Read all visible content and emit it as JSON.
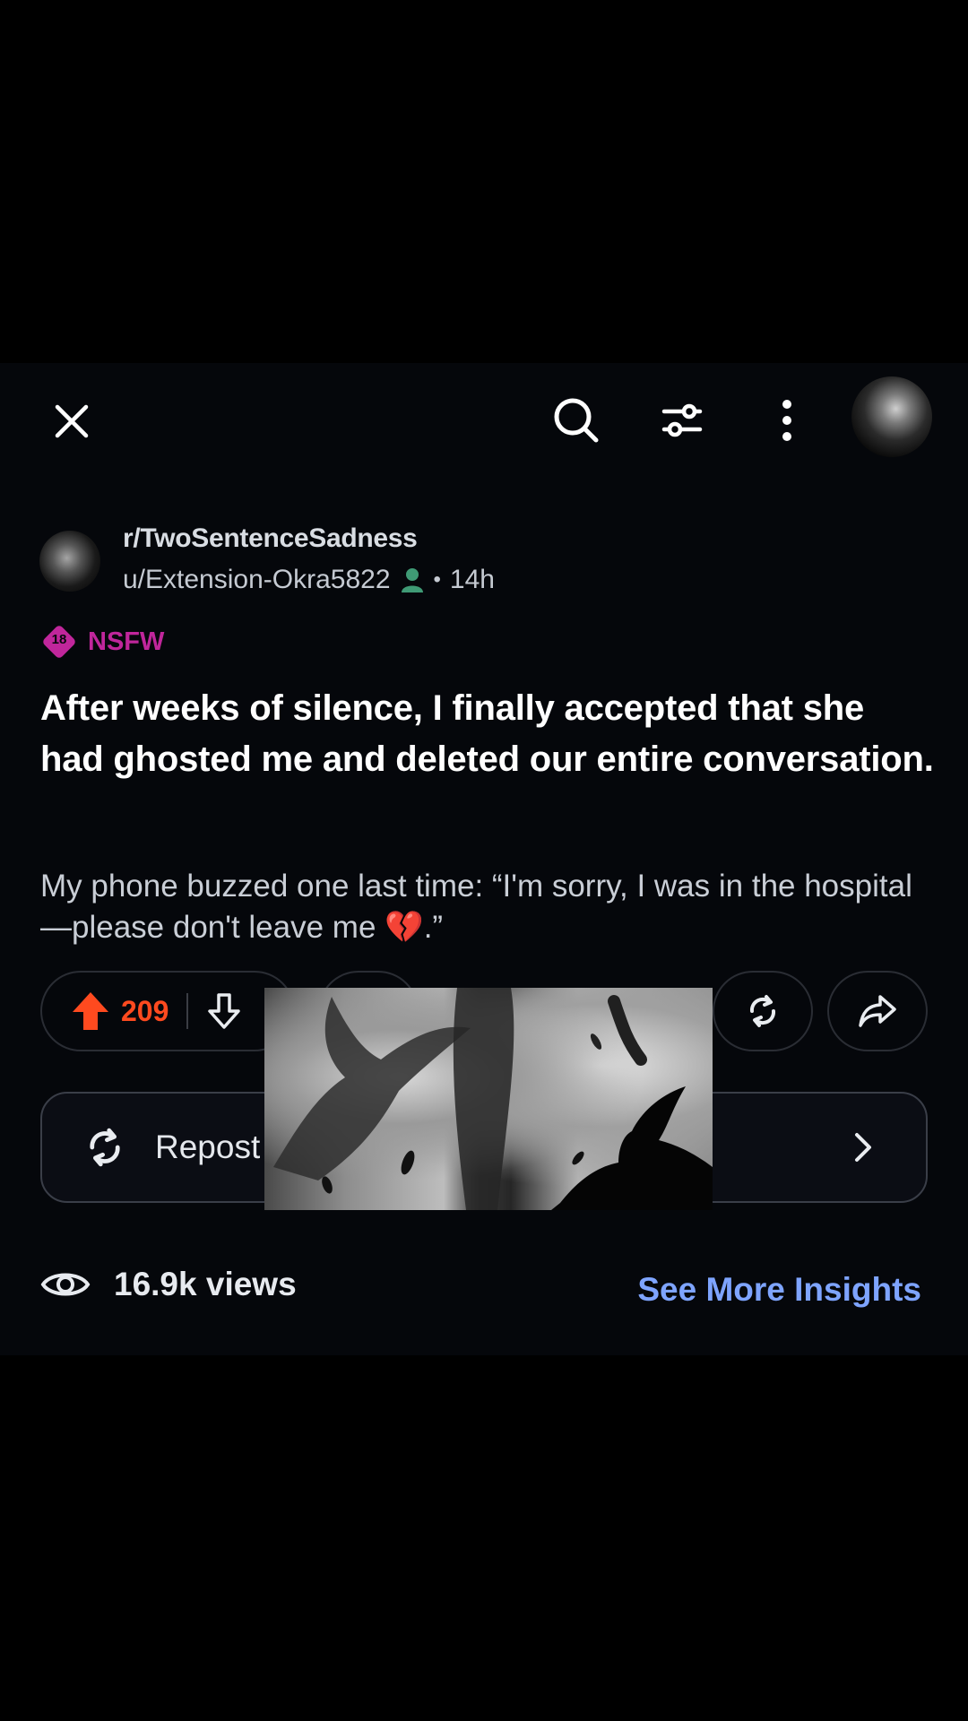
{
  "header": {
    "close_icon": "close-icon",
    "search_icon": "search-icon",
    "filter_icon": "filter-icon",
    "more_icon": "more-vertical-icon",
    "avatar_icon": "avatar"
  },
  "post": {
    "subreddit": "r/TwoSentenceSadness",
    "username": "u/Extension-Okra5822",
    "separator": "•",
    "time": "14h",
    "nsfw_badge": "18",
    "nsfw_label": "NSFW",
    "title": "After weeks of silence, I finally accepted that she had ghosted me and deleted our entire conversation.",
    "body": "My phone buzzed one last time: “I'm sorry, I was in the hospital—please don't leave me 💔.”"
  },
  "actions": {
    "upvotes": "209",
    "repost_label": "Repost"
  },
  "insights": {
    "views": "16.9k views",
    "see_more": "See More Insights"
  },
  "colors": {
    "upvote": "#ff4a1f",
    "nsfw": "#c0269b",
    "link": "#7ea4ff",
    "online": "#3f9a75"
  }
}
